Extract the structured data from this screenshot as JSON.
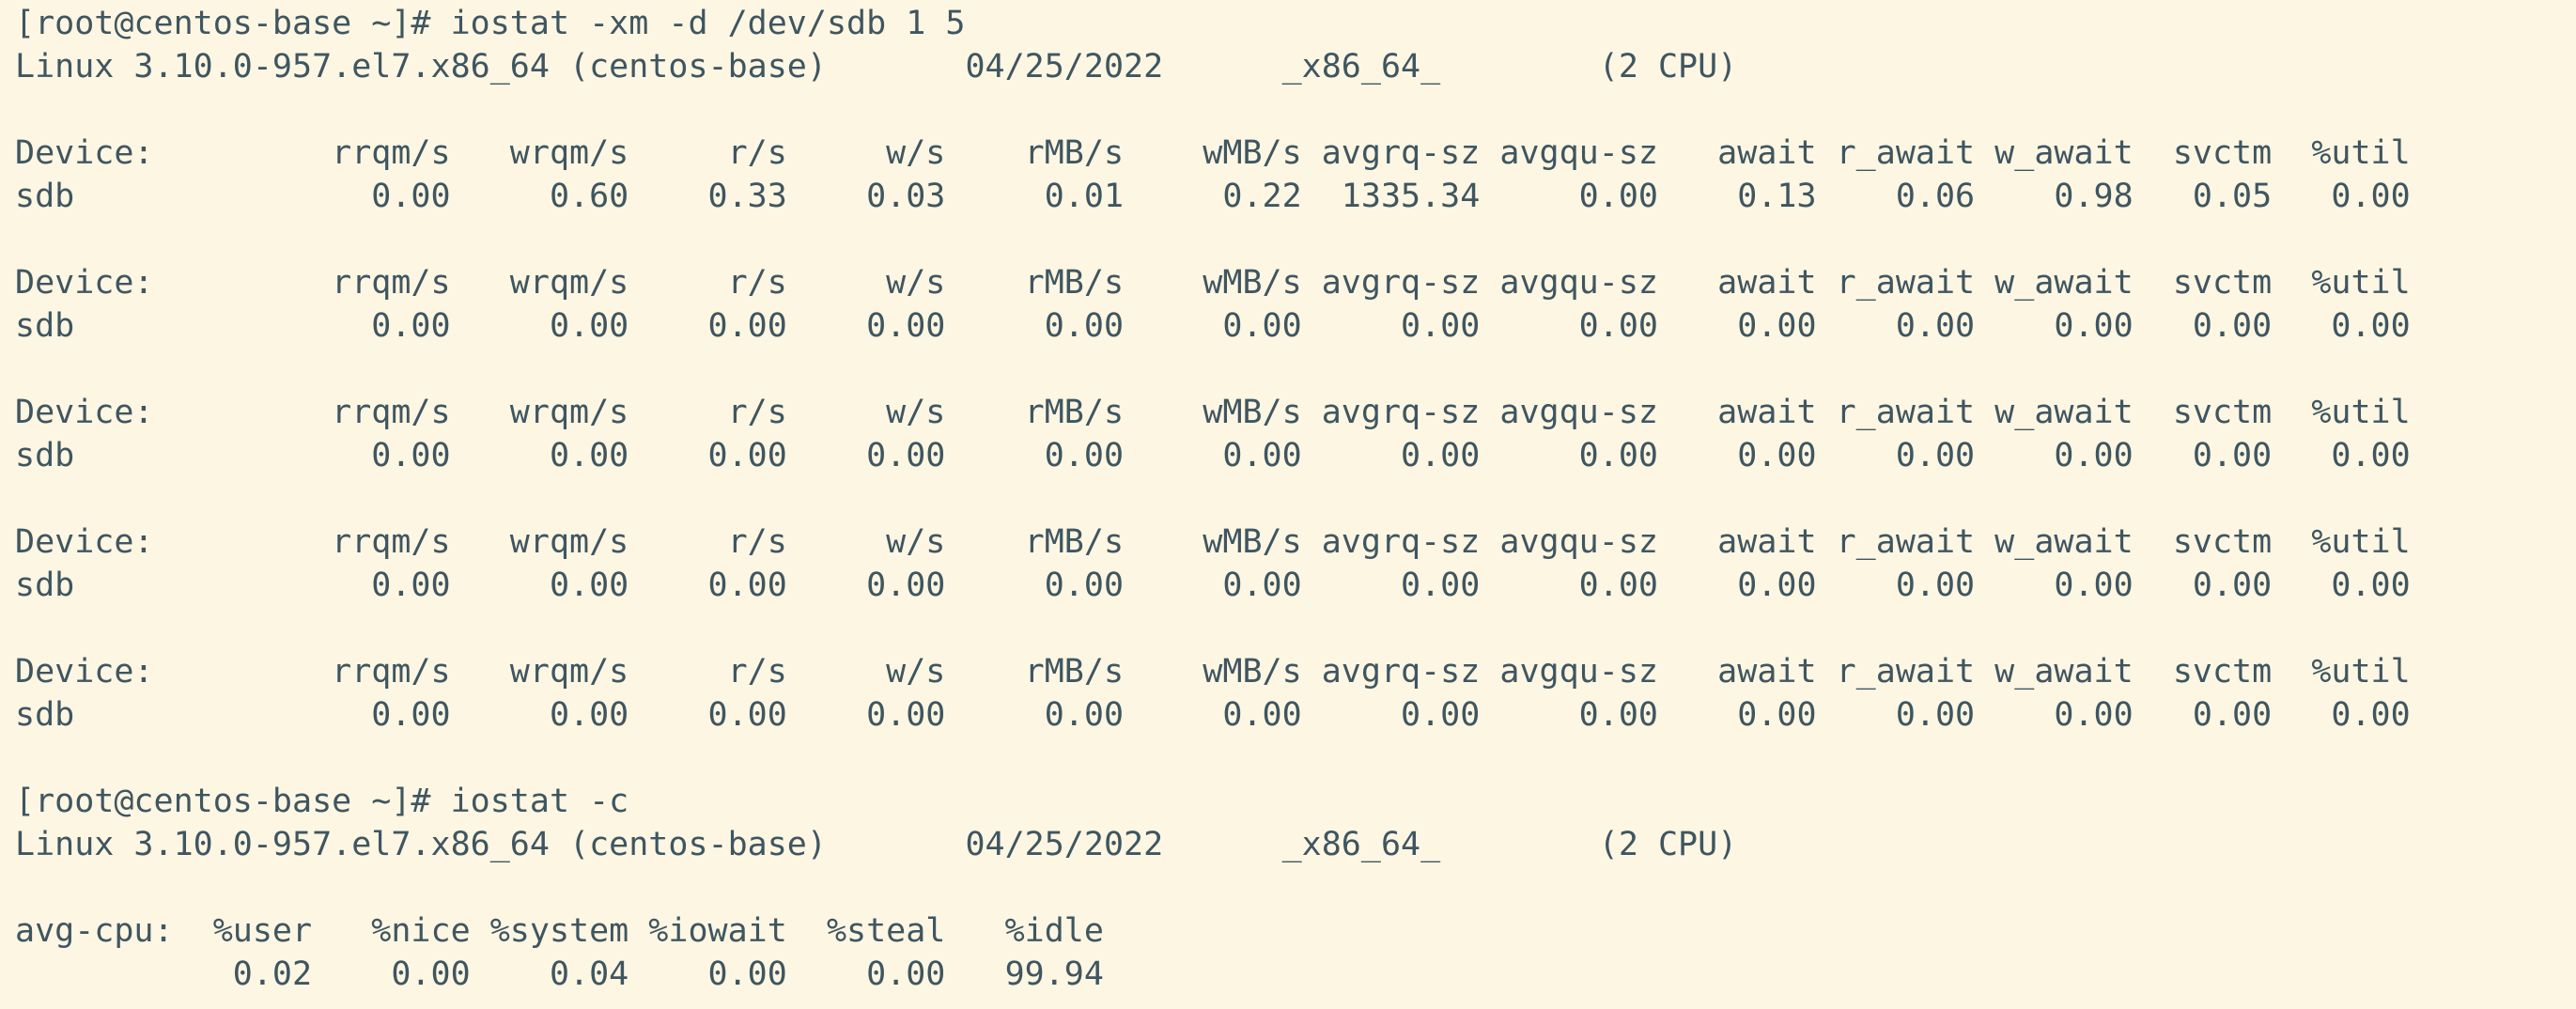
{
  "terminal": {
    "lines": [
      "[root@centos-base ~]# iostat -xm -d /dev/sdb 1 5",
      "Linux 3.10.0-957.el7.x86_64 (centos-base)       04/25/2022      _x86_64_        (2 CPU)",
      "",
      "Device:         rrqm/s   wrqm/s     r/s     w/s    rMB/s    wMB/s avgrq-sz avgqu-sz   await r_await w_await  svctm  %util",
      "sdb               0.00     0.60    0.33    0.03     0.01     0.22  1335.34     0.00    0.13    0.06    0.98   0.05   0.00",
      "",
      "Device:         rrqm/s   wrqm/s     r/s     w/s    rMB/s    wMB/s avgrq-sz avgqu-sz   await r_await w_await  svctm  %util",
      "sdb               0.00     0.00    0.00    0.00     0.00     0.00     0.00     0.00    0.00    0.00    0.00   0.00   0.00",
      "",
      "Device:         rrqm/s   wrqm/s     r/s     w/s    rMB/s    wMB/s avgrq-sz avgqu-sz   await r_await w_await  svctm  %util",
      "sdb               0.00     0.00    0.00    0.00     0.00     0.00     0.00     0.00    0.00    0.00    0.00   0.00   0.00",
      "",
      "Device:         rrqm/s   wrqm/s     r/s     w/s    rMB/s    wMB/s avgrq-sz avgqu-sz   await r_await w_await  svctm  %util",
      "sdb               0.00     0.00    0.00    0.00     0.00     0.00     0.00     0.00    0.00    0.00    0.00   0.00   0.00",
      "",
      "Device:         rrqm/s   wrqm/s     r/s     w/s    rMB/s    wMB/s avgrq-sz avgqu-sz   await r_await w_await  svctm  %util",
      "sdb               0.00     0.00    0.00    0.00     0.00     0.00     0.00     0.00    0.00    0.00    0.00   0.00   0.00",
      "",
      "[root@centos-base ~]# iostat -c",
      "Linux 3.10.0-957.el7.x86_64 (centos-base)       04/25/2022      _x86_64_        (2 CPU)",
      "",
      "avg-cpu:  %user   %nice %system %iowait  %steal   %idle",
      "           0.02    0.00    0.04    0.00    0.00   99.94"
    ]
  },
  "colors": {
    "background": "#fdf6e3",
    "text": "#3f5660"
  }
}
